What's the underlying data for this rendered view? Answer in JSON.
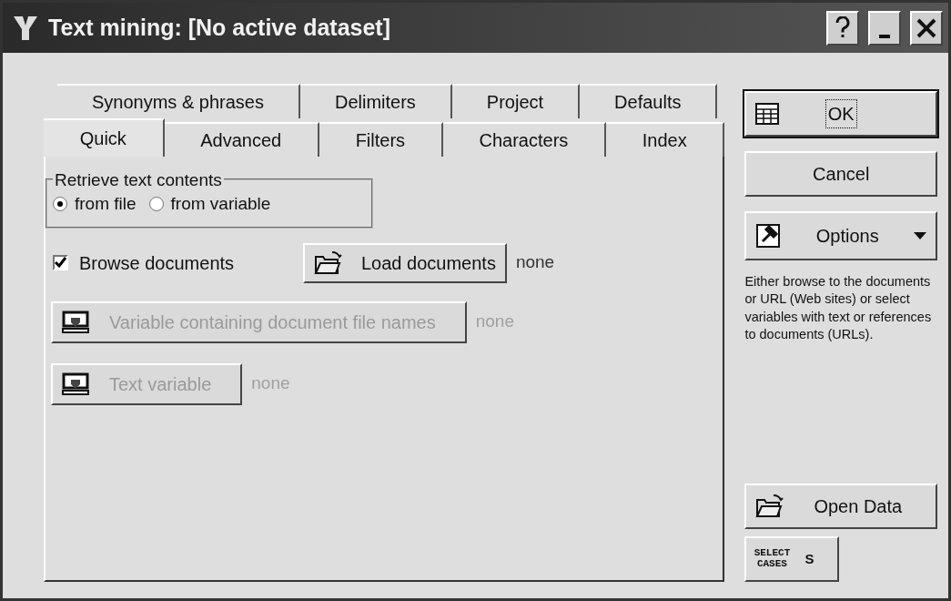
{
  "window": {
    "title": "Text mining: [No active dataset]"
  },
  "tab_rows": [
    [
      {
        "label": "Synonyms & phrases",
        "selected": false
      },
      {
        "label": "Delimiters",
        "selected": false
      },
      {
        "label": "Project",
        "selected": false
      },
      {
        "label": "Defaults",
        "selected": false
      }
    ],
    [
      {
        "label": "Quick",
        "selected": true
      },
      {
        "label": "Advanced",
        "selected": false
      },
      {
        "label": "Filters",
        "selected": false
      },
      {
        "label": "Characters",
        "selected": false
      },
      {
        "label": "Index",
        "selected": false
      }
    ]
  ],
  "retrieve_group": {
    "title": "Retrieve text contents",
    "options": [
      {
        "label": "from file",
        "selected": true
      },
      {
        "label": "from variable",
        "selected": false
      }
    ]
  },
  "browse_checkbox": {
    "label": "Browse documents",
    "checked": true
  },
  "source_buttons": [
    {
      "kind": "load",
      "label": "Load documents",
      "disabled": false,
      "value": "none"
    },
    {
      "kind": "variable",
      "label": "Variable containing document file names",
      "disabled": true,
      "value": "none"
    },
    {
      "kind": "variable",
      "label": "Text variable",
      "disabled": true,
      "value": "none"
    }
  ],
  "side_buttons": [
    {
      "kind": "ok",
      "label": "OK",
      "default": true
    },
    {
      "kind": "plain",
      "label": "Cancel",
      "default": false
    },
    {
      "kind": "options",
      "label": "Options",
      "default": false
    }
  ],
  "help_text": "Either browse to the documents or URL (Web sites) or select variables with text or references to documents (URLs).",
  "open_data_button": {
    "label": "Open Data"
  },
  "select_cases_button": {
    "label": "SELECT CASES",
    "key": "S"
  }
}
